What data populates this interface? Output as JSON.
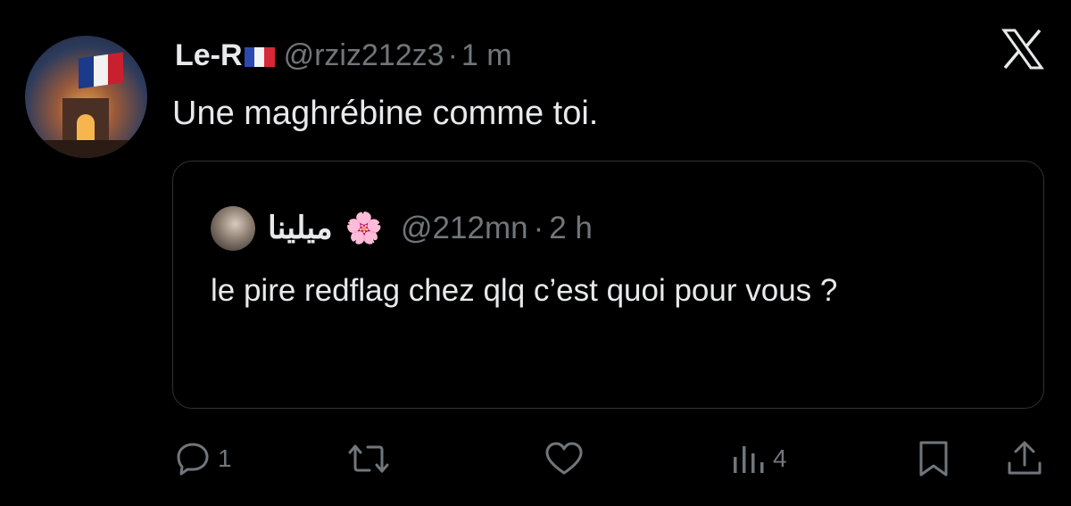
{
  "tweet": {
    "display_name": "Le-R",
    "handle": "@rziz212z3",
    "separator": "·",
    "time": "1 m",
    "text": "Une maghrébine comme toi."
  },
  "quoted_tweet": {
    "display_name": "ميلينا",
    "emoji": "🌸",
    "handle": "@212mn",
    "separator": "·",
    "time": "2 h",
    "text": "le pire redflag chez qlq c’est quoi pour vous ?"
  },
  "actions": {
    "reply_count": "1",
    "views_count": "4"
  },
  "icons": [
    "x-logo-icon",
    "reply-icon",
    "retweet-icon",
    "like-icon",
    "views-icon",
    "bookmark-icon",
    "share-icon"
  ],
  "colors": {
    "background": "#000000",
    "text": "#e7e9ea",
    "muted": "#71767b",
    "border": "#2f3336"
  }
}
